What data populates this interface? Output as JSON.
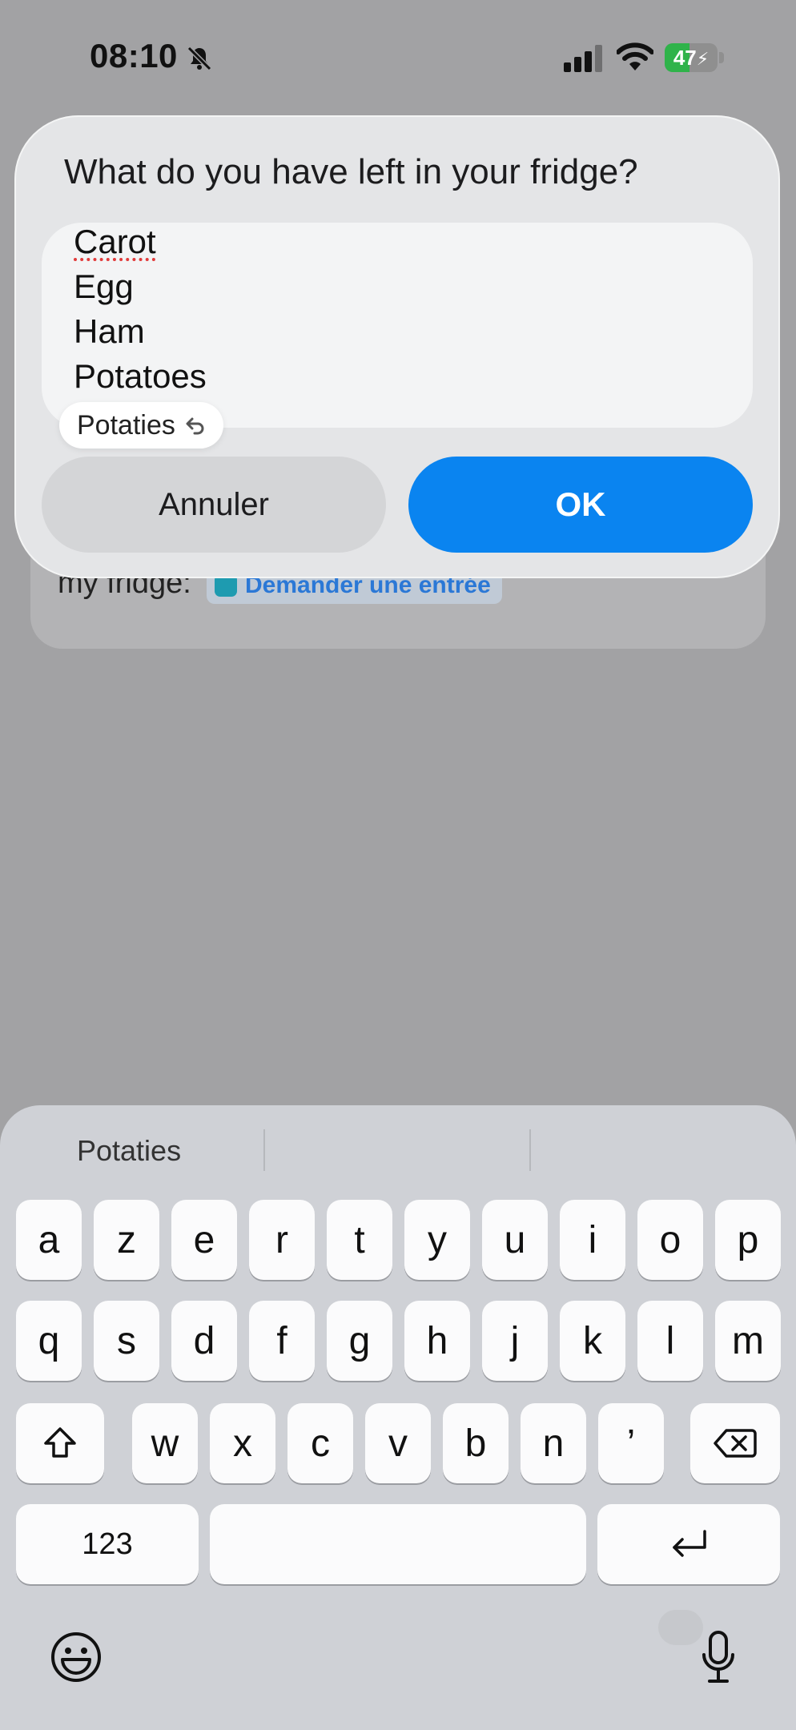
{
  "status_bar": {
    "time": "08:10",
    "battery_level": 47,
    "battery_text": "47"
  },
  "background": {
    "line_text": "my fridge:",
    "chip_text": "Demander une entrée"
  },
  "dialog": {
    "title": "What do you have left in your fridge?",
    "lines": [
      "Carot",
      "Egg",
      "Ham",
      "Potatoes"
    ],
    "misspelled_line": "Carot",
    "autocorrect_suggestion": "Potaties",
    "cancel_label": "Annuler",
    "ok_label": "OK",
    "ok_color": "#0a84f0"
  },
  "keyboard": {
    "prediction": "Potaties",
    "row1": [
      "a",
      "z",
      "e",
      "r",
      "t",
      "y",
      "u",
      "i",
      "o",
      "p"
    ],
    "row2": [
      "q",
      "s",
      "d",
      "f",
      "g",
      "h",
      "j",
      "k",
      "l",
      "m"
    ],
    "row3": [
      "w",
      "x",
      "c",
      "v",
      "b",
      "n",
      "’"
    ],
    "numbers_label": "123",
    "icons": [
      "shift-icon",
      "backspace-icon",
      "return-icon",
      "emoji-icon",
      "microphone-icon"
    ]
  }
}
